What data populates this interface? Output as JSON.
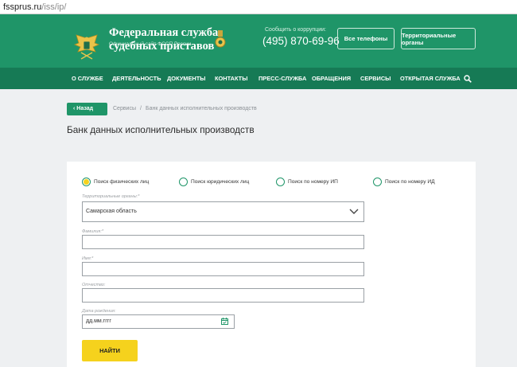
{
  "browser": {
    "url_host": "fssprus.ru",
    "url_path": "/iss/ip/"
  },
  "header": {
    "title_line1": "Федеральная служба",
    "title_line2": "судебных приставов",
    "subtitle": "Официальный сайт ФССП России",
    "corruption_label": "Сообщить о коррупции:",
    "phone": "(495) 870-69-96",
    "all_phones_button": "Все телефоны",
    "territorial_button": "Территориальные органы"
  },
  "nav": {
    "items": [
      "О СЛУЖБЕ",
      "ДЕЯТЕЛЬНОСТЬ",
      "ДОКУМЕНТЫ",
      "КОНТАКТЫ",
      "ПРЕСС-СЛУЖБА",
      "ОБРАЩЕНИЯ",
      "СЕРВИСЫ",
      "ОТКРЫТАЯ СЛУЖБА"
    ]
  },
  "breadcrumb": {
    "back_label": "Назад",
    "items": [
      "Сервисы",
      "Банк данных исполнительных производств"
    ]
  },
  "page": {
    "title": "Банк данных исполнительных производств"
  },
  "form": {
    "search_modes": [
      "Поиск физических лиц",
      "Поиск юридических лиц",
      "Поиск по номеру ИП",
      "Поиск по номеру ИД"
    ],
    "selected_mode": "Поиск физических лиц",
    "region_label": "Территориальные органы:*",
    "region_value": "Самарская область",
    "lastname_label": "Фамилия:*",
    "lastname_value": "",
    "firstname_label": "Имя:*",
    "firstname_value": "",
    "patronymic_label": "Отчество:",
    "patronymic_value": "",
    "birthdate_label": "Дата рождения:",
    "birthdate_placeholder": "дд.мм.гггг",
    "submit_label": "НАЙТИ"
  },
  "colors": {
    "brand_green": "#1f9568",
    "nav_green": "#167a55",
    "accent_yellow": "#f5d21d",
    "background": "#eef0f2"
  },
  "icons": [
    "emblem-logo",
    "medal-icon",
    "search-icon",
    "back-arrow-icon",
    "chevron-down-icon",
    "calendar-icon"
  ]
}
